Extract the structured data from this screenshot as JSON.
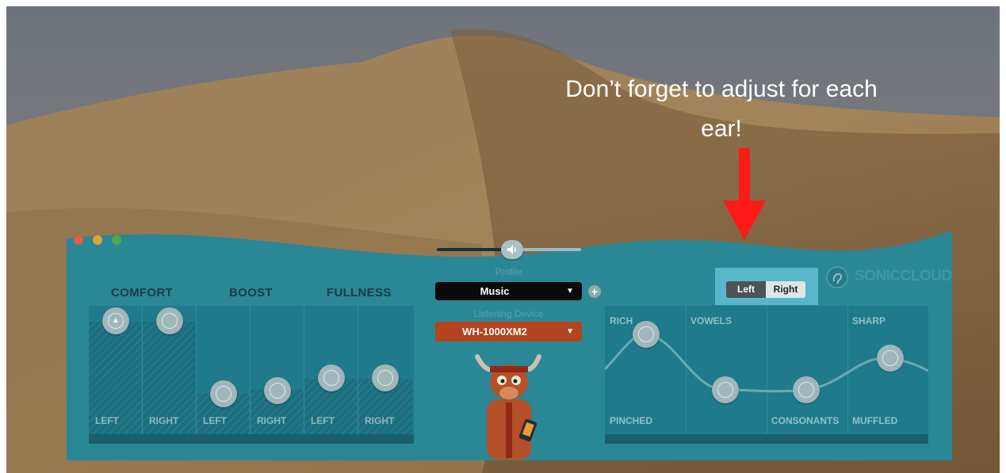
{
  "annotation": {
    "line1": "Don’t forget to adjust for each",
    "line2": "ear!",
    "arrow_color": "#ff1a1a"
  },
  "window": {
    "traffic_lights": [
      "#e05a4f",
      "#d9a63a",
      "#4fa84a"
    ],
    "panel_color": "#2a8796"
  },
  "tabs": [
    "COMFORT",
    "BOOST",
    "FULLNESS"
  ],
  "eq_columns": [
    {
      "group": "COMFORT",
      "channel": "LEFT",
      "level": 0.9
    },
    {
      "group": "COMFORT",
      "channel": "RIGHT",
      "level": 0.9
    },
    {
      "group": "BOOST",
      "channel": "LEFT",
      "level": 0.25
    },
    {
      "group": "BOOST",
      "channel": "RIGHT",
      "level": 0.25
    },
    {
      "group": "FULLNESS",
      "channel": "LEFT",
      "level": 0.45
    },
    {
      "group": "FULLNESS",
      "channel": "RIGHT",
      "level": 0.45
    }
  ],
  "volume": {
    "level": 0.5,
    "icon": "speaker-icon"
  },
  "profile": {
    "caption": "Profile",
    "selected": "Music",
    "add_icon": "plus-icon"
  },
  "device": {
    "caption": "Listening Device",
    "selected": "WH-1000XM2"
  },
  "ear_toggle": {
    "left": "Left",
    "right": "Right",
    "active": "Left"
  },
  "brand": {
    "logo_icon": "ear-icon",
    "name": "SONICCLOUD"
  },
  "tone": {
    "columns": [
      {
        "top": "RICH",
        "bottom": "PINCHED",
        "level": 0.9
      },
      {
        "top": "VOWELS",
        "bottom": "",
        "level": 0.35
      },
      {
        "top": "",
        "bottom": "CONSONANTS",
        "level": 0.35
      },
      {
        "top": "SHARP",
        "bottom": "MUFFLED",
        "level": 0.7
      }
    ]
  },
  "mascot": {
    "icon": "bull-mascot-icon"
  }
}
